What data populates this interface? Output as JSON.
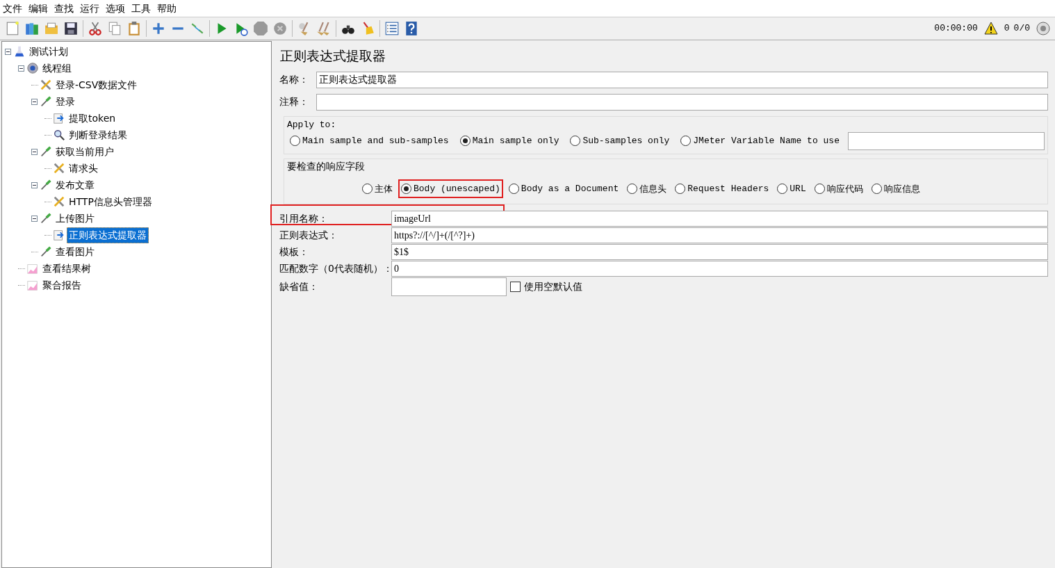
{
  "menu": [
    "文件",
    "编辑",
    "查找",
    "运行",
    "选项",
    "工具",
    "帮助"
  ],
  "status": {
    "timer": "00:00:00",
    "warnings": "0",
    "threads": "0/0"
  },
  "tree": [
    {
      "label": "测试计划",
      "kind": "plan",
      "expanded": true,
      "selected": false,
      "children": [
        {
          "label": "线程组",
          "kind": "threads",
          "expanded": true,
          "selected": false,
          "children": [
            {
              "label": "登录-CSV数据文件",
              "kind": "config",
              "selected": false
            },
            {
              "label": "登录",
              "kind": "sampler",
              "expanded": true,
              "selected": false,
              "children": [
                {
                  "label": "提取token",
                  "kind": "extractor",
                  "selected": false
                },
                {
                  "label": "判断登录结果",
                  "kind": "assertion",
                  "selected": false
                }
              ]
            },
            {
              "label": "获取当前用户",
              "kind": "sampler",
              "expanded": true,
              "selected": false,
              "children": [
                {
                  "label": "请求头",
                  "kind": "config",
                  "selected": false
                }
              ]
            },
            {
              "label": "发布文章",
              "kind": "sampler",
              "expanded": true,
              "selected": false,
              "children": [
                {
                  "label": "HTTP信息头管理器",
                  "kind": "config",
                  "selected": false
                }
              ]
            },
            {
              "label": "上传图片",
              "kind": "sampler",
              "expanded": true,
              "selected": false,
              "children": [
                {
                  "label": "正则表达式提取器",
                  "kind": "extractor",
                  "selected": true
                }
              ]
            },
            {
              "label": "查看图片",
              "kind": "sampler",
              "selected": false
            }
          ]
        },
        {
          "label": "查看结果树",
          "kind": "listener",
          "selected": false
        },
        {
          "label": "聚合报告",
          "kind": "listener",
          "selected": false
        }
      ]
    }
  ],
  "panel": {
    "title": "正则表达式提取器",
    "name": {
      "label": "名称：",
      "value": "正则表达式提取器"
    },
    "comment": {
      "label": "注释："
    },
    "apply_to": {
      "legend": "Apply to:",
      "options": [
        {
          "label": "Main sample and sub-samples",
          "selected": false
        },
        {
          "label": "Main sample only",
          "selected": true
        },
        {
          "label": "Sub-samples only",
          "selected": false
        },
        {
          "label": "JMeter Variable Name to use",
          "selected": false
        }
      ]
    },
    "response_field": {
      "legend": "要检查的响应字段",
      "options": [
        {
          "label": "主体",
          "selected": false,
          "highlighted": false
        },
        {
          "label": "Body (unescaped)",
          "selected": true,
          "highlighted": true
        },
        {
          "label": "Body as a Document",
          "selected": false,
          "highlighted": false
        },
        {
          "label": "信息头",
          "selected": false,
          "highlighted": false
        },
        {
          "label": "Request Headers",
          "selected": false,
          "highlighted": false
        },
        {
          "label": "URL",
          "selected": false,
          "highlighted": false
        },
        {
          "label": "响应代码",
          "selected": false,
          "highlighted": false
        },
        {
          "label": "响应信息",
          "selected": false,
          "highlighted": false
        }
      ]
    },
    "fields": [
      {
        "label": "引用名称：",
        "value": "imageUrl",
        "highlighted": true
      },
      {
        "label": "正则表达式：",
        "value": "https?://[^/]+(/[^?]+)",
        "highlighted": false
      },
      {
        "label": "模板：",
        "value": "$1$",
        "highlighted": false
      },
      {
        "label": "匹配数字（0代表随机）：",
        "value": "0",
        "highlighted": false
      },
      {
        "label": "缺省值：",
        "highlighted": false
      }
    ],
    "empty_default": {
      "label": "使用空默认值",
      "checked": false
    }
  }
}
